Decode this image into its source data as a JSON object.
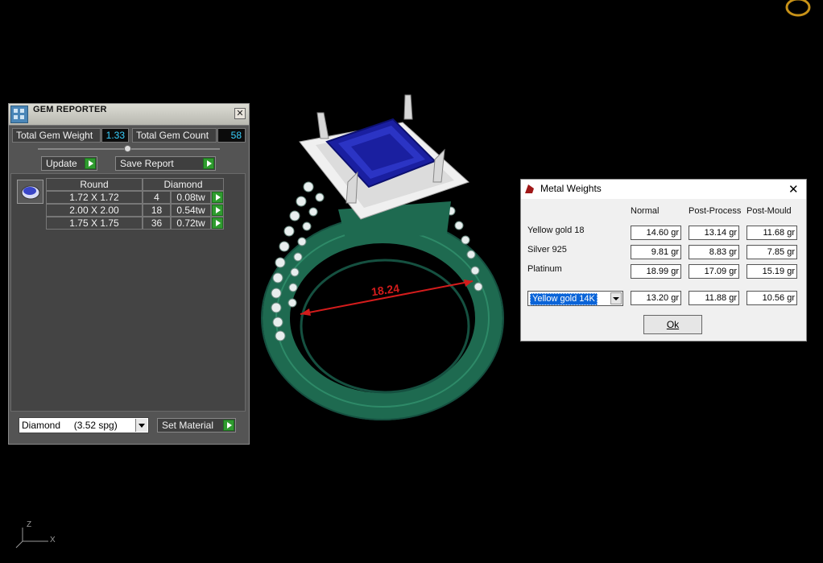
{
  "gem_reporter": {
    "title": "GEM REPORTER",
    "close_glyph": "✕",
    "total_weight_label": "Total Gem Weight",
    "total_weight_value": "1.33",
    "total_count_label": "Total Gem Count",
    "total_count_value": "58",
    "update_label": "Update",
    "save_report_label": "Save Report",
    "table": {
      "headers": [
        "Round",
        "Diamond"
      ],
      "rows": [
        {
          "size": "1.72 X 1.72",
          "count": "4",
          "weight": "0.08tw"
        },
        {
          "size": "2.00 X 2.00",
          "count": "18",
          "weight": "0.54tw"
        },
        {
          "size": "1.75 X 1.75",
          "count": "36",
          "weight": "0.72tw"
        }
      ]
    },
    "material_dropdown": "Diamond     (3.52 spg)",
    "set_material_label": "Set Material"
  },
  "viewport": {
    "dimension_label": "18.24",
    "axis_z": "Z",
    "axis_x": "X"
  },
  "metal_weights": {
    "title": "Metal Weights",
    "close_glyph": "✕",
    "columns": [
      "Normal",
      "Post-Process",
      "Post-Mould"
    ],
    "rows": [
      {
        "name": "Yellow gold 18",
        "values": [
          "14.60 gr",
          "13.14 gr",
          "11.68 gr"
        ]
      },
      {
        "name": "Silver 925",
        "values": [
          "9.81 gr",
          "8.83 gr",
          "7.85 gr"
        ]
      },
      {
        "name": "Platinum",
        "values": [
          "18.99 gr",
          "17.09 gr",
          "15.19 gr"
        ]
      }
    ],
    "custom": {
      "selected": "Yellow gold 14K",
      "values": [
        "13.20 gr",
        "11.88 gr",
        "10.56 gr"
      ]
    },
    "ok_label": "Ok"
  },
  "colors": {
    "accent_blue": "#38d0ff",
    "play_green": "#2f9b2f",
    "ring_green": "#1e6a50",
    "stone_blue": "#1a1fa0",
    "measure_red": "#d41c1c"
  }
}
